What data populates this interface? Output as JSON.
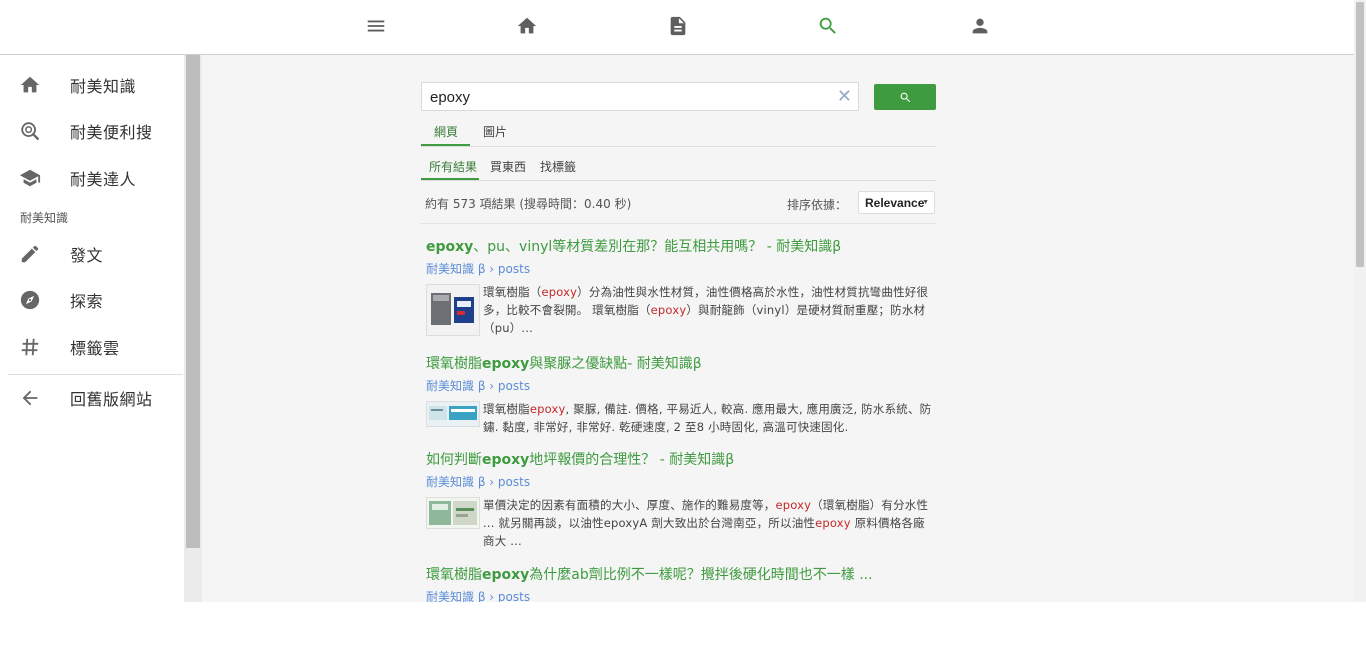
{
  "topnav": {
    "items": [
      {
        "name": "menu",
        "icon": "menu-icon"
      },
      {
        "name": "home",
        "icon": "home-icon"
      },
      {
        "name": "posts",
        "icon": "document-icon"
      },
      {
        "name": "search",
        "icon": "search-icon",
        "active": true
      },
      {
        "name": "account",
        "icon": "person-icon"
      }
    ]
  },
  "sidebar": {
    "items": [
      {
        "label": "耐美知識",
        "icon": "home-icon"
      },
      {
        "label": "耐美便利搜",
        "icon": "search-globe-icon"
      },
      {
        "label": "耐美達人",
        "icon": "graduation-cap-icon"
      }
    ],
    "section_title": "耐美知識",
    "section_items": [
      {
        "label": "發文",
        "icon": "pencil-icon"
      },
      {
        "label": "探索",
        "icon": "compass-icon"
      },
      {
        "label": "標籤雲",
        "icon": "hashtag-icon"
      }
    ],
    "back_item": {
      "label": "回舊版網站",
      "icon": "arrow-left-icon"
    }
  },
  "search": {
    "query": "epoxy",
    "clear_icon": "close-icon",
    "button_icon": "search-icon"
  },
  "tabs": [
    {
      "label": "網頁",
      "active": true
    },
    {
      "label": "圖片",
      "active": false
    }
  ],
  "refinements": [
    {
      "label": "所有結果",
      "active": true
    },
    {
      "label": "買東西",
      "active": false
    },
    {
      "label": "找標籤",
      "active": false
    }
  ],
  "results_info": {
    "count_text": "約有 573 項結果 (搜尋時間：0.40 秒)",
    "sort_label": "排序依據：",
    "sort_value": "Relevance"
  },
  "results": [
    {
      "title_parts": [
        [
          "epoxy",
          true
        ],
        [
          "、pu、vinyl等材質差別在那？能互相共用嗎？ - 耐美知識β",
          false
        ]
      ],
      "url": "耐美知識 β › posts",
      "snippet_parts": [
        [
          "環氧樹脂（",
          false
        ],
        [
          "epoxy",
          true
        ],
        [
          "）分為油性與水性材質，油性價格高於水性，油性材質抗彎曲性好很多，比較不會裂開。 環氧樹脂（",
          false
        ],
        [
          "epoxy",
          true
        ],
        [
          "）與耐龍飾（vinyl）是硬材質耐重壓；防水材（pu）...",
          false
        ]
      ]
    },
    {
      "title_parts": [
        [
          "環氧樹脂",
          false
        ],
        [
          "epoxy",
          true
        ],
        [
          "與聚脲之優缺點- 耐美知識β",
          false
        ]
      ],
      "url": "耐美知識 β › posts",
      "snippet_parts": [
        [
          "環氧樹脂",
          false
        ],
        [
          "epoxy",
          true
        ],
        [
          ", 聚脲, 備註. 價格, 平易近人, 較高. 應用最大, 應用廣泛, 防水系統、防鏽. 黏度, 非常好, 非常好. 乾硬速度, 2 至8 小時固化, 高溫可快速固化.",
          false
        ]
      ]
    },
    {
      "title_parts": [
        [
          "如何判斷",
          false
        ],
        [
          "epoxy",
          true
        ],
        [
          "地坪報價的合理性？ - 耐美知識β",
          false
        ]
      ],
      "url": "耐美知識 β › posts",
      "snippet_parts": [
        [
          "單價決定的因素有面積的大小、厚度、施作的難易度等，",
          false
        ],
        [
          "epoxy",
          true
        ],
        [
          "（環氧樹脂）有分水性 ... 就另關再談，以油性epoxyA 劑大致出於台灣南亞，所以油性",
          false
        ],
        [
          "epoxy",
          true
        ],
        [
          " 原料價格各廠商大 ...",
          false
        ]
      ]
    },
    {
      "title_parts": [
        [
          "環氧樹脂",
          false
        ],
        [
          "epoxy",
          true
        ],
        [
          "為什麼ab劑比例不一樣呢？攪拌後硬化時間也不一樣 ...",
          false
        ]
      ],
      "url": "耐美知識 β › posts",
      "snippet_parts": []
    }
  ],
  "colors": {
    "accent": "#3e9b3f",
    "link_blue": "#5b8dd6",
    "highlight_red": "#c62828",
    "main_bg": "#f5f5f5"
  }
}
